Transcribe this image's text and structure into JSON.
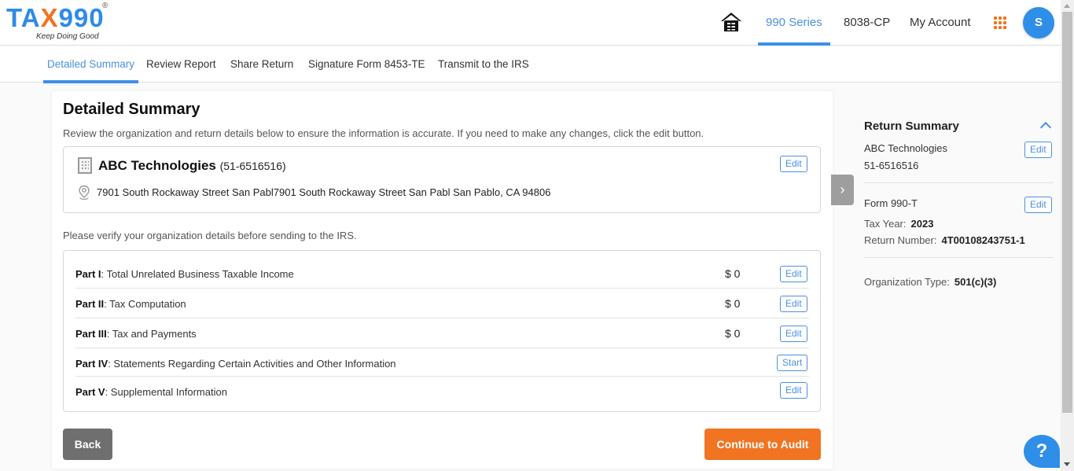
{
  "brand": {
    "logo_text_a": "TA",
    "logo_text_x": "X",
    "logo_text_b": "990",
    "registered": "®",
    "tagline": "Keep Doing Good",
    "accent_color": "#2e8be8",
    "orange_color": "#f07422"
  },
  "header": {
    "home_icon": "home-icon",
    "nav": [
      {
        "label": "990 Series",
        "active": true
      },
      {
        "label": "8038-CP",
        "active": false
      },
      {
        "label": "My Account",
        "active": false
      }
    ],
    "apps_icon": "grid-apps-icon",
    "avatar_initial": "S"
  },
  "subnav": {
    "tabs": [
      {
        "label": "Detailed Summary",
        "active": true
      },
      {
        "label": "Review Report",
        "active": false
      },
      {
        "label": "Share Return",
        "active": false
      },
      {
        "label": "Signature Form 8453-TE",
        "active": false
      },
      {
        "label": "Transmit to the IRS",
        "active": false
      }
    ]
  },
  "main": {
    "title": "Detailed Summary",
    "description": "Review the organization and return details below to ensure the information is accurate. If you need to make any changes, click the edit button.",
    "organization": {
      "name": "ABC Technologies",
      "ein": "(51-6516516)",
      "address": "7901 South Rockaway Street San Pabl7901 South Rockaway Street San Pabl San Pablo, CA 94806",
      "edit_label": "Edit"
    },
    "verify_text": "Please verify your organization details before sending to the IRS.",
    "parts": [
      {
        "part": "Part I",
        "title": ": Total Unrelated Business Taxable Income",
        "amount": "$ 0",
        "action": "Edit"
      },
      {
        "part": "Part II",
        "title": ": Tax Computation",
        "amount": "$ 0",
        "action": "Edit"
      },
      {
        "part": "Part III",
        "title": ": Tax and Payments",
        "amount": "$ 0",
        "action": "Edit"
      },
      {
        "part": "Part IV",
        "title": ": Statements Regarding Certain Activities and Other Information",
        "amount": "",
        "action": "Start"
      },
      {
        "part": "Part V",
        "title": ": Supplemental Information",
        "amount": "",
        "action": "Edit"
      }
    ],
    "back_label": "Back",
    "continue_label": "Continue to Audit"
  },
  "summary": {
    "title": "Return Summary",
    "org_name": "ABC Technologies",
    "ein": "51-6516516",
    "form": "Form 990-T",
    "tax_year_label": "Tax Year:",
    "tax_year": "2023",
    "return_number_label": "Return Number:",
    "return_number": "4T00108243751-1",
    "org_type_label": "Organization Type:",
    "org_type": "501(c)(3)",
    "edit_label": "Edit"
  },
  "help": {
    "label": "?"
  }
}
